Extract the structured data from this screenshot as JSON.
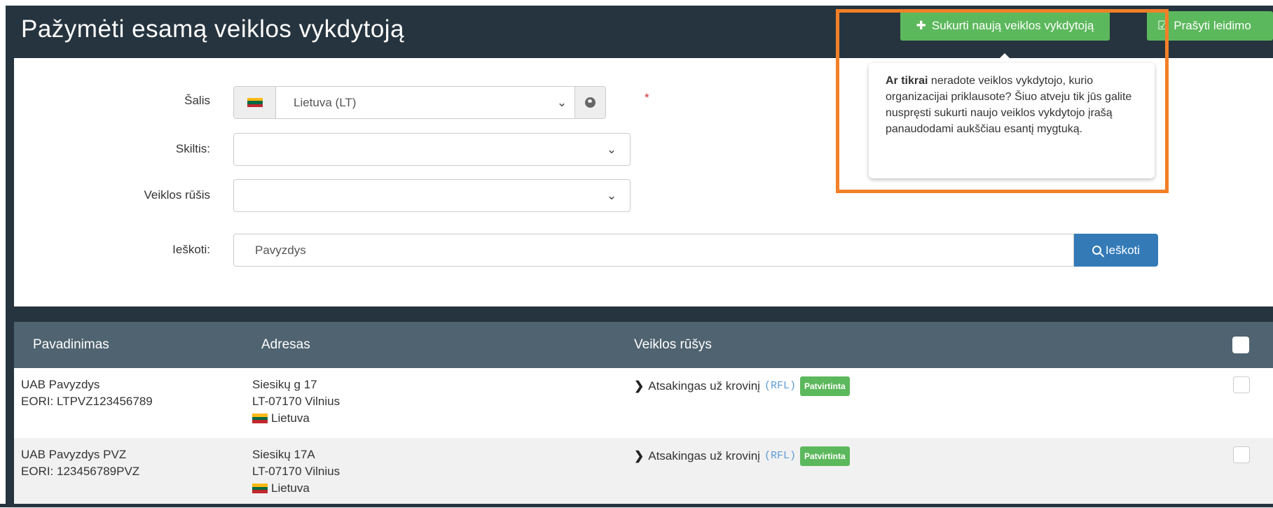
{
  "page_title": "Pažymėti esamą veiklos vykdytoją",
  "header_buttons": {
    "create_label": "Sukurti naują veiklos vykdytoją",
    "request_label": "Prašyti leidimo"
  },
  "tooltip": {
    "bold": "Ar tikrai",
    "text": " neradote veiklos vykdytojo, kurio organizacijai priklausote? Šiuo atveju tik jūs galite nuspręsti sukurti naujo veiklos vykdytojo įrašą panaudodami aukščiau esantį mygtuką."
  },
  "form": {
    "country_label": "Šalis",
    "country_value": "Lietuva (LT)",
    "section_label": "Skiltis:",
    "activity_label": "Veiklos rūšis",
    "search_label": "Ieškoti:",
    "search_value": "Pavyzdys",
    "search_button": "Ieškoti",
    "required_mark": "*"
  },
  "table": {
    "headers": {
      "name": "Pavadinimas",
      "address": "Adresas",
      "activities": "Veiklos rūšys"
    },
    "rows": [
      {
        "name": "UAB Pavyzdys",
        "eori": "EORI: LTPVZ123456789",
        "street": "Siesikų g 17",
        "city": "LT-07170 Vilnius",
        "country": "Lietuva",
        "activity": "Atsakingas už krovinį",
        "code": "(RFL)",
        "status": "Patvirtinta"
      },
      {
        "name": "UAB Pavyzdys PVZ",
        "eori": "EORI: 123456789PVZ",
        "street": "Siesikų 17A",
        "city": "LT-07170 Vilnius",
        "country": "Lietuva",
        "activity": "Atsakingas už krovinį",
        "code": "(RFL)",
        "status": "Patvirtinta"
      }
    ]
  },
  "colors": {
    "header_bg": "#26343f",
    "table_header_bg": "#4f6370",
    "success": "#5cb85c",
    "primary": "#337ab7",
    "highlight": "#f28028"
  }
}
